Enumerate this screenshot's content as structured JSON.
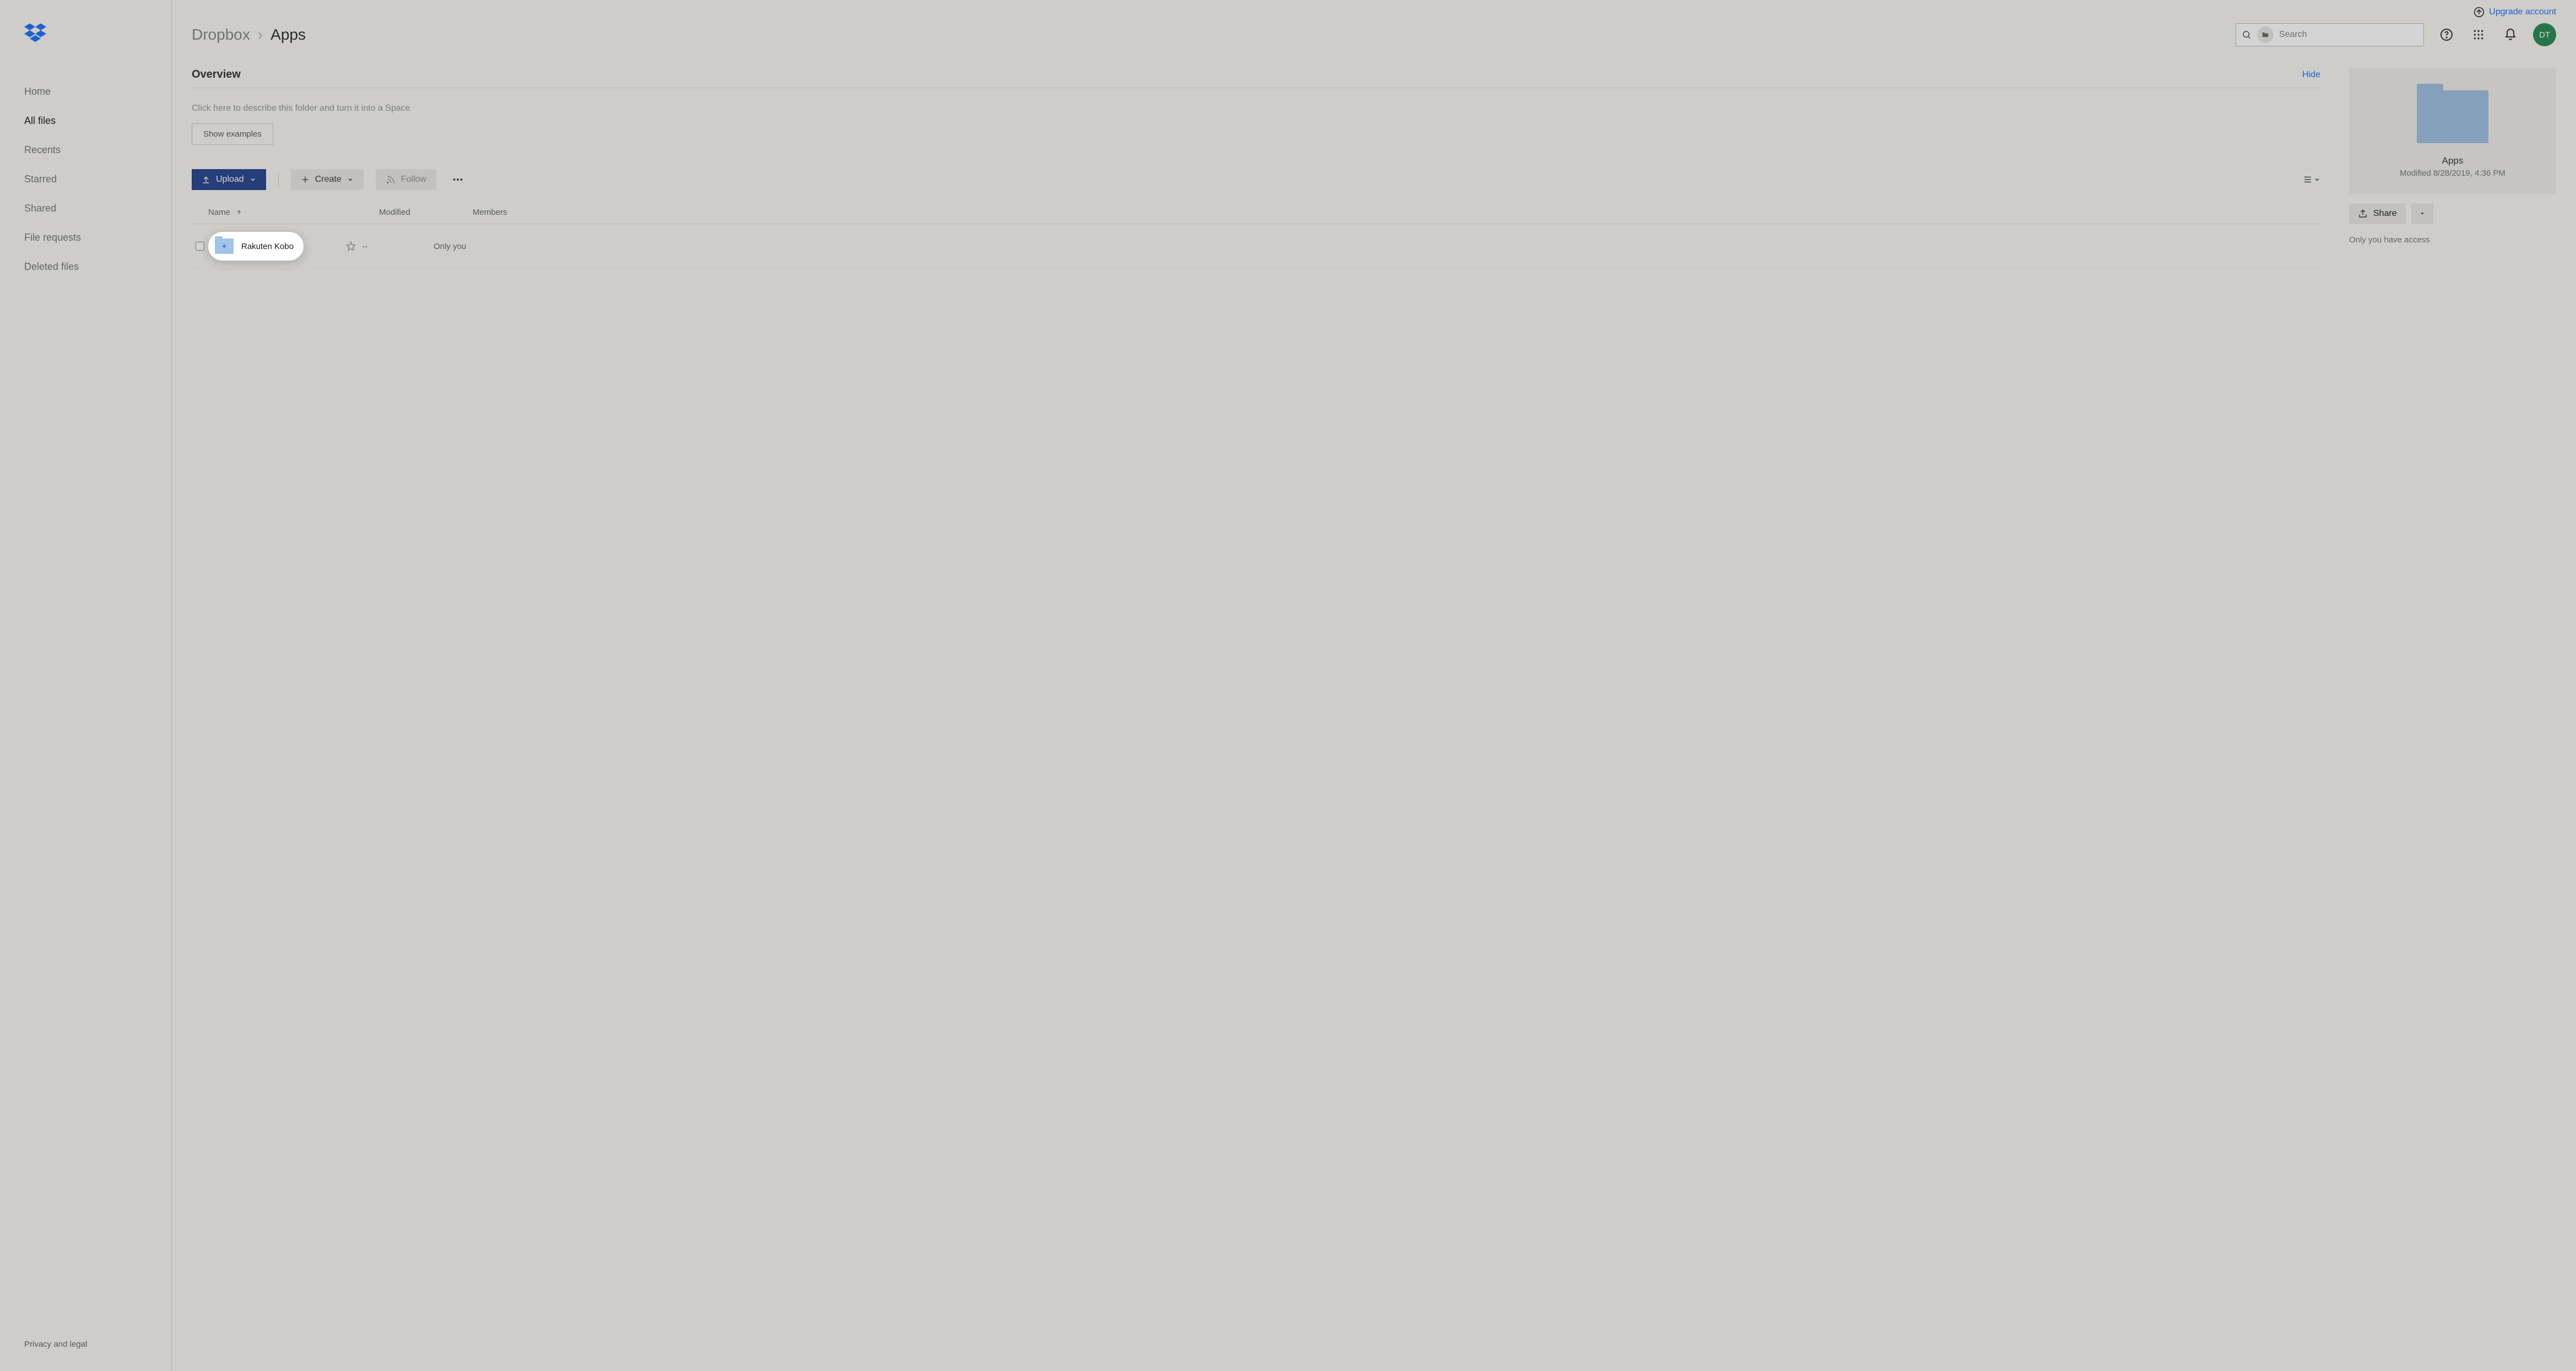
{
  "top": {
    "upgrade": "Upgrade account"
  },
  "sidebar": {
    "items": [
      {
        "label": "Home"
      },
      {
        "label": "All files"
      },
      {
        "label": "Recents"
      },
      {
        "label": "Starred"
      },
      {
        "label": "Shared"
      },
      {
        "label": "File requests"
      },
      {
        "label": "Deleted files"
      }
    ],
    "footer": "Privacy and legal"
  },
  "header": {
    "root": "Dropbox",
    "sep": "›",
    "current": "Apps",
    "search_placeholder": "Search",
    "avatar": "DT"
  },
  "overview": {
    "title": "Overview",
    "hide": "Hide",
    "placeholder": "Click here to describe this folder and turn it into a Space",
    "show_examples": "Show examples"
  },
  "toolbar": {
    "upload": "Upload",
    "create": "Create",
    "follow": "Follow"
  },
  "table": {
    "col_name": "Name",
    "col_modified": "Modified",
    "col_members": "Members",
    "rows": [
      {
        "name": "Rakuten Kobo",
        "modified": "--",
        "members": "Only you"
      }
    ]
  },
  "details": {
    "title": "Apps",
    "subtitle": "Modified 8/28/2019, 4:36 PM",
    "share": "Share",
    "access": "Only you have access"
  }
}
